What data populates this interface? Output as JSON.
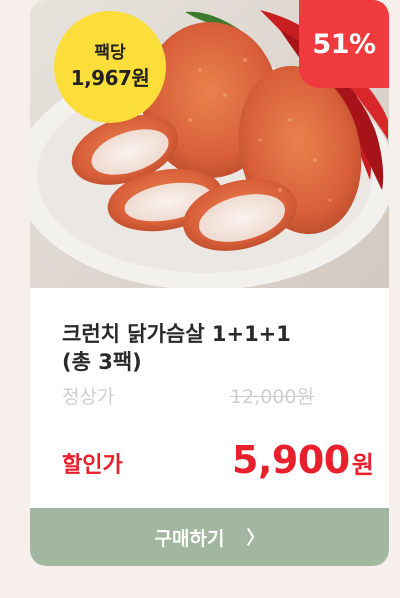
{
  "product": {
    "title_line1": "크런치 닭가슴살 1+1+1",
    "title_line2": "(총 3팩)",
    "image_alt": "크런치 닭가슴살"
  },
  "badges": {
    "per_pack_label": "팩당",
    "per_pack_price": "1,967원",
    "discount": "51%"
  },
  "pricing": {
    "original_label": "정상가",
    "original_price": "12,000원",
    "sale_label": "할인가",
    "sale_price": "5,900",
    "currency": "원"
  },
  "cta": {
    "label": "구매하기",
    "chevron": "〉"
  },
  "colors": {
    "page_bg": "#f6efec",
    "badge_yellow": "#fcde3a",
    "discount_red": "#ef3b3d",
    "price_red": "#e8202b",
    "button_green": "#a2b79f"
  }
}
